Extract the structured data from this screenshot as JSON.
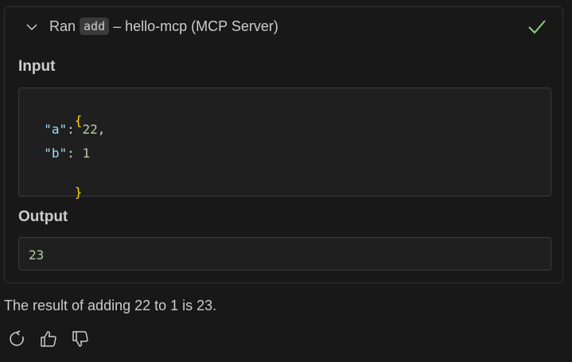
{
  "tool_call": {
    "ran_label": "Ran",
    "tool_name": "add",
    "server_label": "– hello-mcp (MCP Server)",
    "status": "success",
    "status_color": "#89d185",
    "input_label": "Input",
    "input": {
      "open_brace": "{",
      "close_brace": "}",
      "a_key": "\"a\"",
      "a_value": "22",
      "b_key": "\"b\"",
      "b_value": "1"
    },
    "output_label": "Output",
    "output_value": "23"
  },
  "assistant": {
    "message": "The result of adding 22 to 1 is 23."
  },
  "actions": [
    "retry-icon",
    "thumbs-up-icon",
    "thumbs-down-icon"
  ]
}
